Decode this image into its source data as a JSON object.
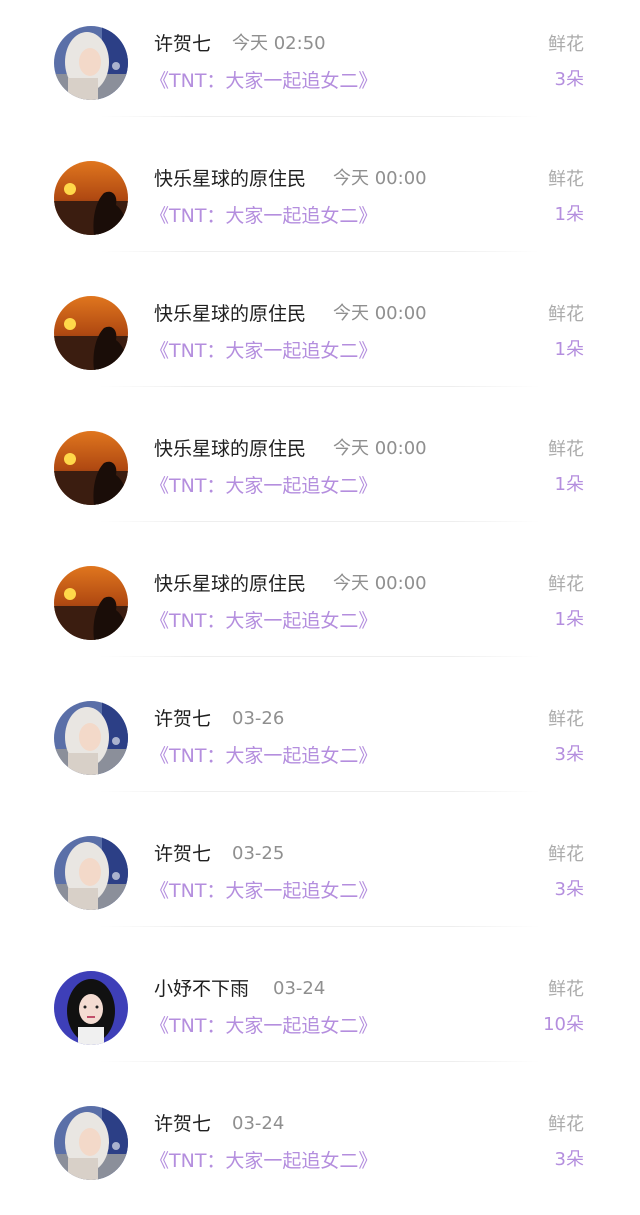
{
  "rows": [
    {
      "name": "许贺七",
      "time": "今天 02:50",
      "book": "《TNT：大家一起追女二》",
      "gift_label": "鲜花",
      "gift_count": "3朵",
      "avatar": "avatar-silver-hair"
    },
    {
      "name": "快乐星球的原住民",
      "time": "今天 00:00",
      "book": "《TNT：大家一起追女二》",
      "gift_label": "鲜花",
      "gift_count": "1朵",
      "avatar": "avatar-sunset"
    },
    {
      "name": "快乐星球的原住民",
      "time": "今天 00:00",
      "book": "《TNT：大家一起追女二》",
      "gift_label": "鲜花",
      "gift_count": "1朵",
      "avatar": "avatar-sunset"
    },
    {
      "name": "快乐星球的原住民",
      "time": "今天 00:00",
      "book": "《TNT：大家一起追女二》",
      "gift_label": "鲜花",
      "gift_count": "1朵",
      "avatar": "avatar-sunset"
    },
    {
      "name": "快乐星球的原住民",
      "time": "今天 00:00",
      "book": "《TNT：大家一起追女二》",
      "gift_label": "鲜花",
      "gift_count": "1朵",
      "avatar": "avatar-sunset"
    },
    {
      "name": "许贺七",
      "time": "03-26",
      "book": "《TNT：大家一起追女二》",
      "gift_label": "鲜花",
      "gift_count": "3朵",
      "avatar": "avatar-silver-hair"
    },
    {
      "name": "许贺七",
      "time": "03-25",
      "book": "《TNT：大家一起追女二》",
      "gift_label": "鲜花",
      "gift_count": "3朵",
      "avatar": "avatar-silver-hair"
    },
    {
      "name": "小妤不下雨",
      "time": "03-24",
      "book": "《TNT：大家一起追女二》",
      "gift_label": "鲜花",
      "gift_count": "10朵",
      "avatar": "avatar-dark-hair"
    },
    {
      "name": "许贺七",
      "time": "03-24",
      "book": "《TNT：大家一起追女二》",
      "gift_label": "鲜花",
      "gift_count": "3朵",
      "avatar": "avatar-silver-hair"
    }
  ]
}
